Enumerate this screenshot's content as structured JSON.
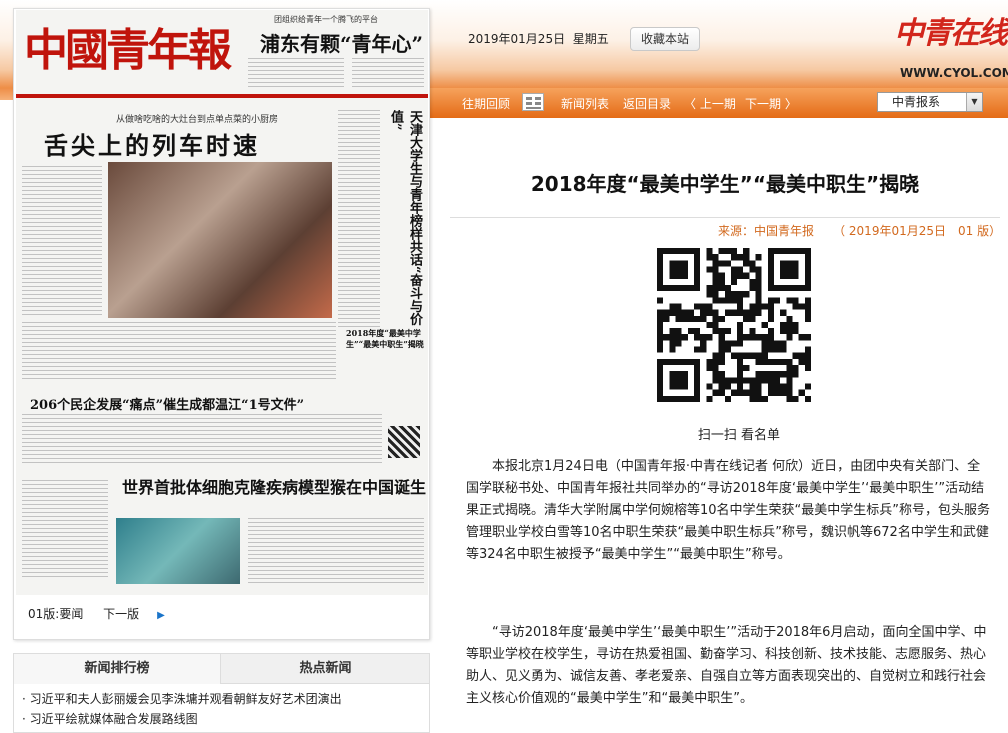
{
  "header": {
    "date": "2019年01月25日",
    "weekday": "星期五",
    "favorite_button": "收藏本站",
    "logo_text": "中青在线",
    "logo_url": "WWW.CYOL.COM"
  },
  "nav": {
    "past_review": "往期回顾",
    "news_list": "新闻列表",
    "back_to_toc": "返回目录",
    "prev_issue": "〈 上一期",
    "next_issue": "下一期 〉",
    "paper_select": "中青报系"
  },
  "newspaper": {
    "masthead": "中國青年報",
    "top_headline_kicker": "团组织给青年一个腾飞的平台",
    "top_headline": "浦东有颗“青年心”",
    "main_kicker": "从做啥吃啥的大灶台到点单点菜的小厨房",
    "main_headline": "舌尖上的列车时速",
    "vertical_headline": "天津大学生与青年榜样共话“奋斗与价值”",
    "side_box": "2018年度“最美中学生”“最美中职生”揭晓",
    "headline_2": "206个民企发展“痛点”催生成都温江“1号文件”",
    "headline_3": "世界首批体细胞克隆疾病模型猴在中国诞生",
    "page_label": "01版:要闻",
    "next_page": "下一版"
  },
  "tabs": {
    "ranking": "新闻排行榜",
    "hot": "热点新闻"
  },
  "news_list": [
    "· 习近平和夫人彭丽媛会见李洙墉并观看朝鲜友好艺术团演出",
    "· 习近平绘就媒体融合发展路线图"
  ],
  "article": {
    "title": "2018年度“最美中学生”“最美中职生”揭晓",
    "source_label": "来源：中国青年报",
    "source_date": "（ 2019年01月25日　01 版）",
    "qr_caption": "扫一扫  看名单",
    "paragraphs": [
      "本报北京1月24日电（中国青年报·中青在线记者 何欣）近日，由团中央有关部门、全国学联秘书处、中国青年报社共同举办的“寻访2018年度‘最美中学生’‘最美中职生’”活动结果正式揭晓。清华大学附属中学何婉榕等10名中学生荣获“最美中学生标兵”称号，包头服务管理职业学校白雪等10名中职生荣获“最美中职生标兵”称号，魏识帆等672名中学生和武健等324名中职生被授予“最美中学生”“最美中职生”称号。",
      "“寻访2018年度‘最美中学生’‘最美中职生’”活动于2018年6月启动，面向全国中学、中等职业学校在校学生，寻访在热爱祖国、勤奋学习、科技创新、技术技能、志愿服务、热心助人、见义勇为、诚信友善、孝老爱亲、自强自立等方面表现突出的、自觉树立和践行社会主义核心价值观的“最美中学生”和“最美中职生”。"
    ]
  }
}
